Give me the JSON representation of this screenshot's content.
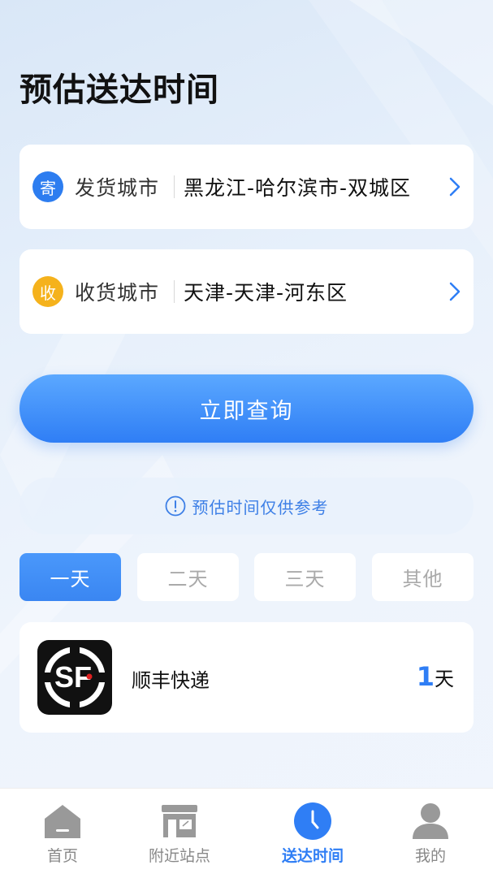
{
  "header": {
    "title": "预估送达时间"
  },
  "sender": {
    "badge": "寄",
    "label": "发货城市",
    "value": "黑龙江-哈尔滨市-双城区",
    "icon": "chevron-right-icon"
  },
  "receiver": {
    "badge": "收",
    "label": "收货城市",
    "value": "天津-天津-河东区",
    "icon": "chevron-right-icon"
  },
  "query_button": {
    "label": "立即查询"
  },
  "notice": {
    "icon": "info-circle-icon",
    "text": "预估时间仅供参考"
  },
  "day_tabs": [
    {
      "label": "一天",
      "active": true
    },
    {
      "label": "二天",
      "active": false
    },
    {
      "label": "三天",
      "active": false
    },
    {
      "label": "其他",
      "active": false
    }
  ],
  "results": [
    {
      "logo_icon": "sf-express-logo",
      "logo_text": "SF",
      "name": "顺丰快递",
      "days": "1",
      "unit": "天"
    }
  ],
  "tabbar": [
    {
      "label": "首页",
      "icon": "home-icon",
      "active": false
    },
    {
      "label": "附近站点",
      "icon": "store-icon",
      "active": false
    },
    {
      "label": "送达时间",
      "icon": "clock-icon",
      "active": true
    },
    {
      "label": "我的",
      "icon": "user-icon",
      "active": false
    }
  ],
  "colors": {
    "accent": "#2f7ef5",
    "sender_badge": "#2d7df0",
    "receiver_badge": "#f5b21c",
    "inactive_icon": "#999999"
  }
}
